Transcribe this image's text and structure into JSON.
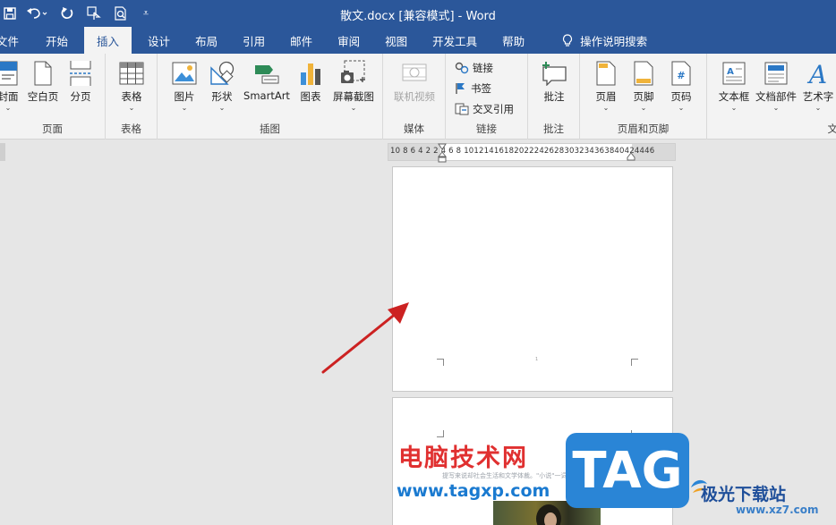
{
  "titlebar": {
    "title": "散文.docx [兼容模式]  -  Word",
    "qat_customize": "⩡"
  },
  "tabs": [
    {
      "label": "文件",
      "active": false
    },
    {
      "label": "开始",
      "active": false
    },
    {
      "label": "插入",
      "active": true
    },
    {
      "label": "设计",
      "active": false
    },
    {
      "label": "布局",
      "active": false
    },
    {
      "label": "引用",
      "active": false
    },
    {
      "label": "邮件",
      "active": false
    },
    {
      "label": "审阅",
      "active": false
    },
    {
      "label": "视图",
      "active": false
    },
    {
      "label": "开发工具",
      "active": false
    },
    {
      "label": "帮助",
      "active": false
    }
  ],
  "search": {
    "label": "操作说明搜索"
  },
  "ribbon": {
    "groups": {
      "pages": "页面",
      "tables": "表格",
      "illustrations": "插图",
      "media": "媒体",
      "links": "链接",
      "comments": "批注",
      "header_footer": "页眉和页脚",
      "text": "文"
    },
    "buttons": {
      "cover": "封面",
      "blank_page": "空白页",
      "page_break": "分页",
      "table": "表格",
      "picture": "图片",
      "shapes": "形状",
      "smartart": "SmartArt",
      "chart": "图表",
      "screenshot": "屏幕截图",
      "online_video": "联机视频",
      "link": "链接",
      "bookmark": "书签",
      "cross_ref": "交叉引用",
      "comment": "批注",
      "header": "页眉",
      "footer": "页脚",
      "page_number": "页码",
      "text_box": "文本框",
      "quick_parts": "文档部件",
      "wordart": "艺术字"
    },
    "caret": "⌄"
  },
  "ruler": {
    "text": "10 8 6 4 2     2 4 6 8 10121416182022242628303234363840424446"
  },
  "page1": {
    "footer_mark": "1"
  },
  "watermark": {
    "cn": "电脑技术网",
    "url": "www.tagxp.com",
    "tag": "TAG",
    "brand": "极光下载站",
    "brand_url": "www.xz7.com"
  },
  "page2_faint": [
    "提写来说却社会生活和文学体裁。\"小说\"一词出"
  ],
  "colors": {
    "accent": "#2b579a",
    "arrow": "#cc2222"
  }
}
